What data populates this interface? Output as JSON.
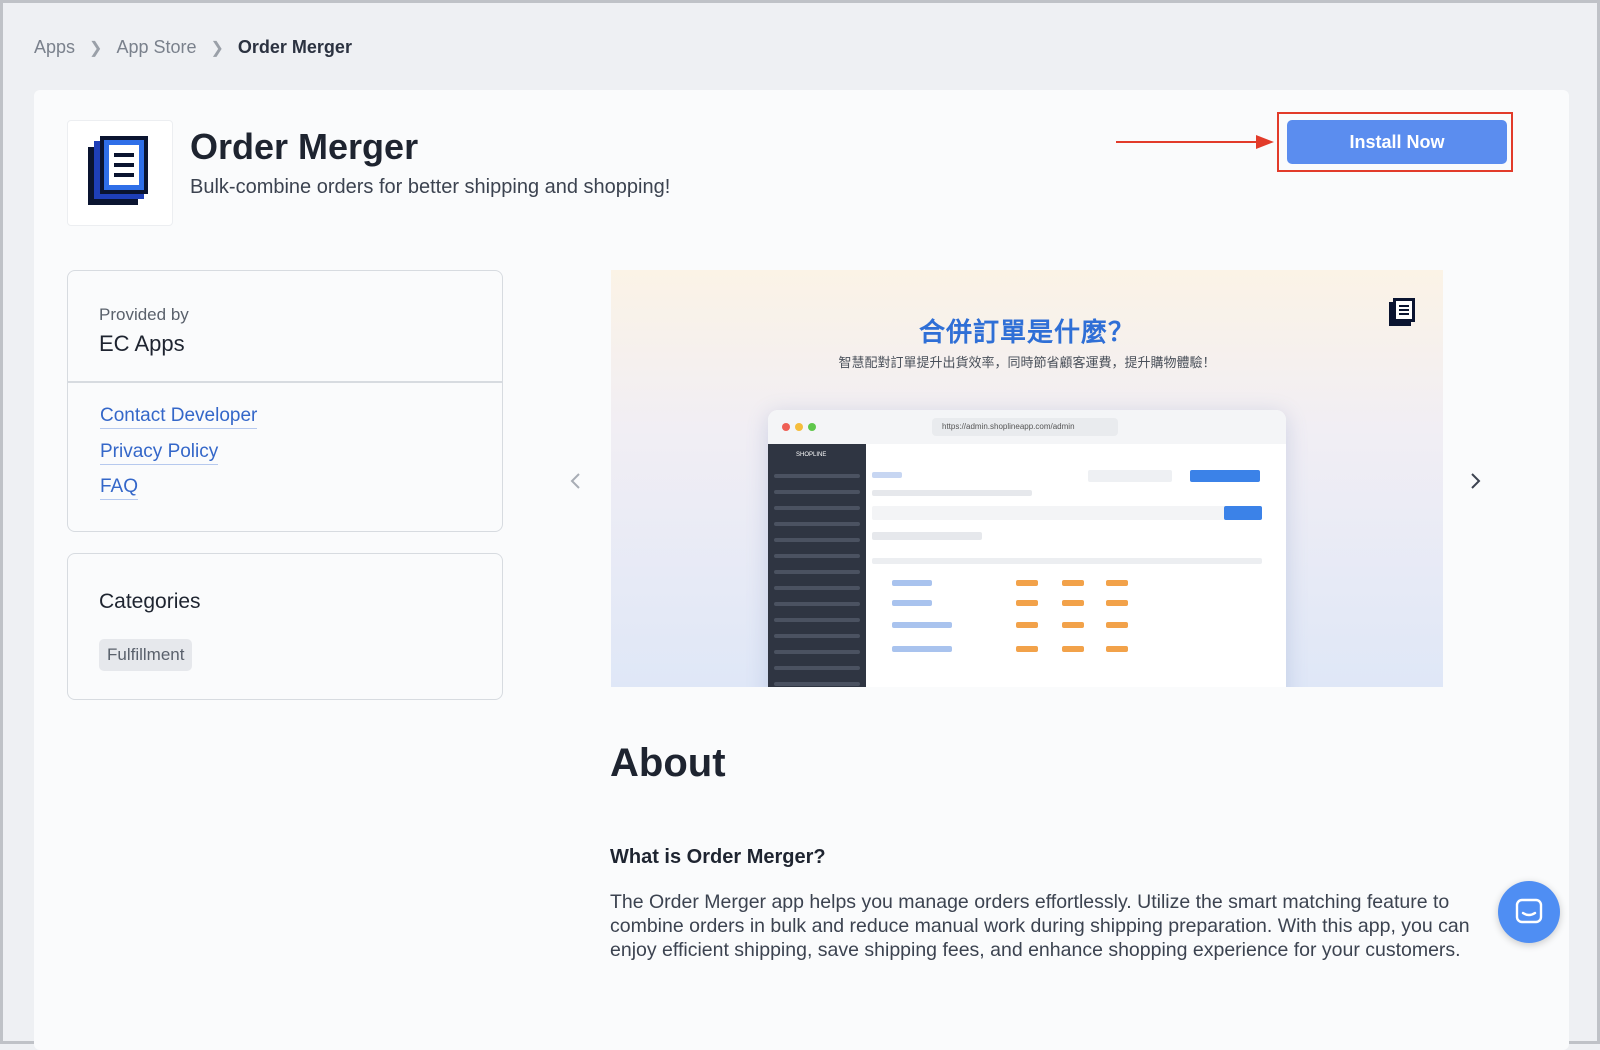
{
  "breadcrumb": {
    "items": [
      "Apps",
      "App Store",
      "Order Merger"
    ]
  },
  "app": {
    "title": "Order Merger",
    "subtitle": "Bulk-combine orders for better shipping and shopping!",
    "install_label": "Install Now"
  },
  "provider": {
    "label": "Provided by",
    "name": "EC Apps",
    "links": [
      "Contact Developer",
      "Privacy Policy",
      "FAQ"
    ]
  },
  "categories": {
    "title": "Categories",
    "items": [
      "Fulfillment"
    ]
  },
  "banner": {
    "title": "合併訂單是什麼？",
    "subtitle": "智慧配對訂單提升出貨效率，同時節省顧客運費，提升購物體驗！",
    "url": "https://admin.shoplineapp.com/admin",
    "brand": "SHOPLINE"
  },
  "about": {
    "heading": "About",
    "question": "What is Order Merger?",
    "body": "The Order Merger app helps you manage orders effortlessly. Utilize the smart matching feature to combine orders in bulk and reduce manual work during shipping preparation. With this app, you can enjoy efficient shipping, save shipping fees, and enhance shopping experience for your customers."
  },
  "colors": {
    "accent": "#5b8def",
    "highlight": "#e23b2a",
    "link": "#3467c9"
  }
}
